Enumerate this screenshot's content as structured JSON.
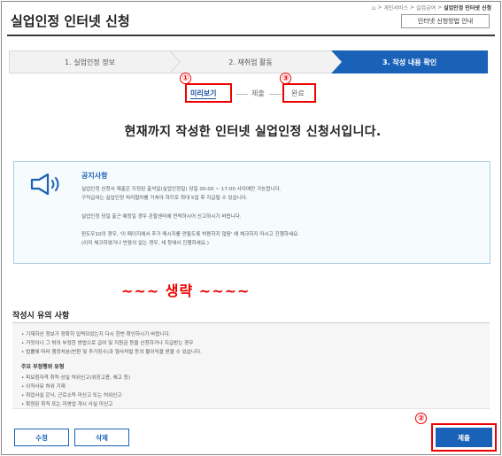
{
  "breadcrumb": {
    "items": [
      "개인서비스",
      "실업급여",
      "실업인정 인터넷 신청"
    ]
  },
  "header": {
    "title": "실업인정 인터넷 신청",
    "guide_button": "인터넷 신청방법 안내"
  },
  "steps": [
    {
      "label": "1. 실업인정 정보",
      "active": false
    },
    {
      "label": "2. 재취업 활동",
      "active": false
    },
    {
      "label": "3. 작성 내용 확인",
      "active": true
    }
  ],
  "sub_tabs": {
    "preview": "미리보기",
    "submit": "제출",
    "complete": "완료"
  },
  "annotations": {
    "mark1": "①",
    "mark2": "②",
    "mark3": "③",
    "omitted": "~~~ 생략 ~~~~"
  },
  "headline": "현재까지 작성한 인터넷 실업인정 신청서입니다.",
  "notice": {
    "title": "공지사항",
    "lines": [
      "실업인정 신청서 제출은 지정된 출석일(실업인정일) 당일 00:00 ~ 17:00 사이에만 가능합니다.",
      "구직급여는 실업인정 처리절차를 거쳐야 하므로 최대 5일 후 지급될 수 있습니다.",
      "실업인정 당일 출근 예정일 경우 관할센터에 연락하시어 신고하시기 바랍니다.",
      "윈도우10의 경우, '이 페이지에서 추가 메시지를 만들도록 허용하지 않음' 에 체크하지 마시고 진행하세요.",
      "(이미 체크하였거나 반응이 없는 경우, 새 창에서 진행하세요.)"
    ]
  },
  "caution": {
    "title": "작성시 유의 사항",
    "lines": [
      "• 기재하신 정보가 정확히 입력되었는지 다시 한번 확인하시기 바랍니다.",
      "• 거짓이나 그 밖의 부정한 방법으로 급여 및 지원금 등을 신청하거나 지급받는 경우",
      "• 법률에 따라 행정처분(반환 및 추가징수)과 형사처벌 등의 불이익을 받을 수 있습니다."
    ],
    "fraud_title": "주요 부정행위 유형",
    "fraud_lines": [
      "• 피보험자격 취득·상실 허위신고(위장고용, 해고 등)",
      "• 이직사유 허위 기재",
      "• 취업사실 은닉, 근로소득 미신고 또는 허위신고",
      "• 확정된 취직 또는 자영업 개시 사실 미신고"
    ]
  },
  "buttons": {
    "edit": "수정",
    "delete": "삭제",
    "submit": "제출"
  },
  "colors": {
    "primary": "#1a62b8",
    "highlight": "#e00000"
  }
}
